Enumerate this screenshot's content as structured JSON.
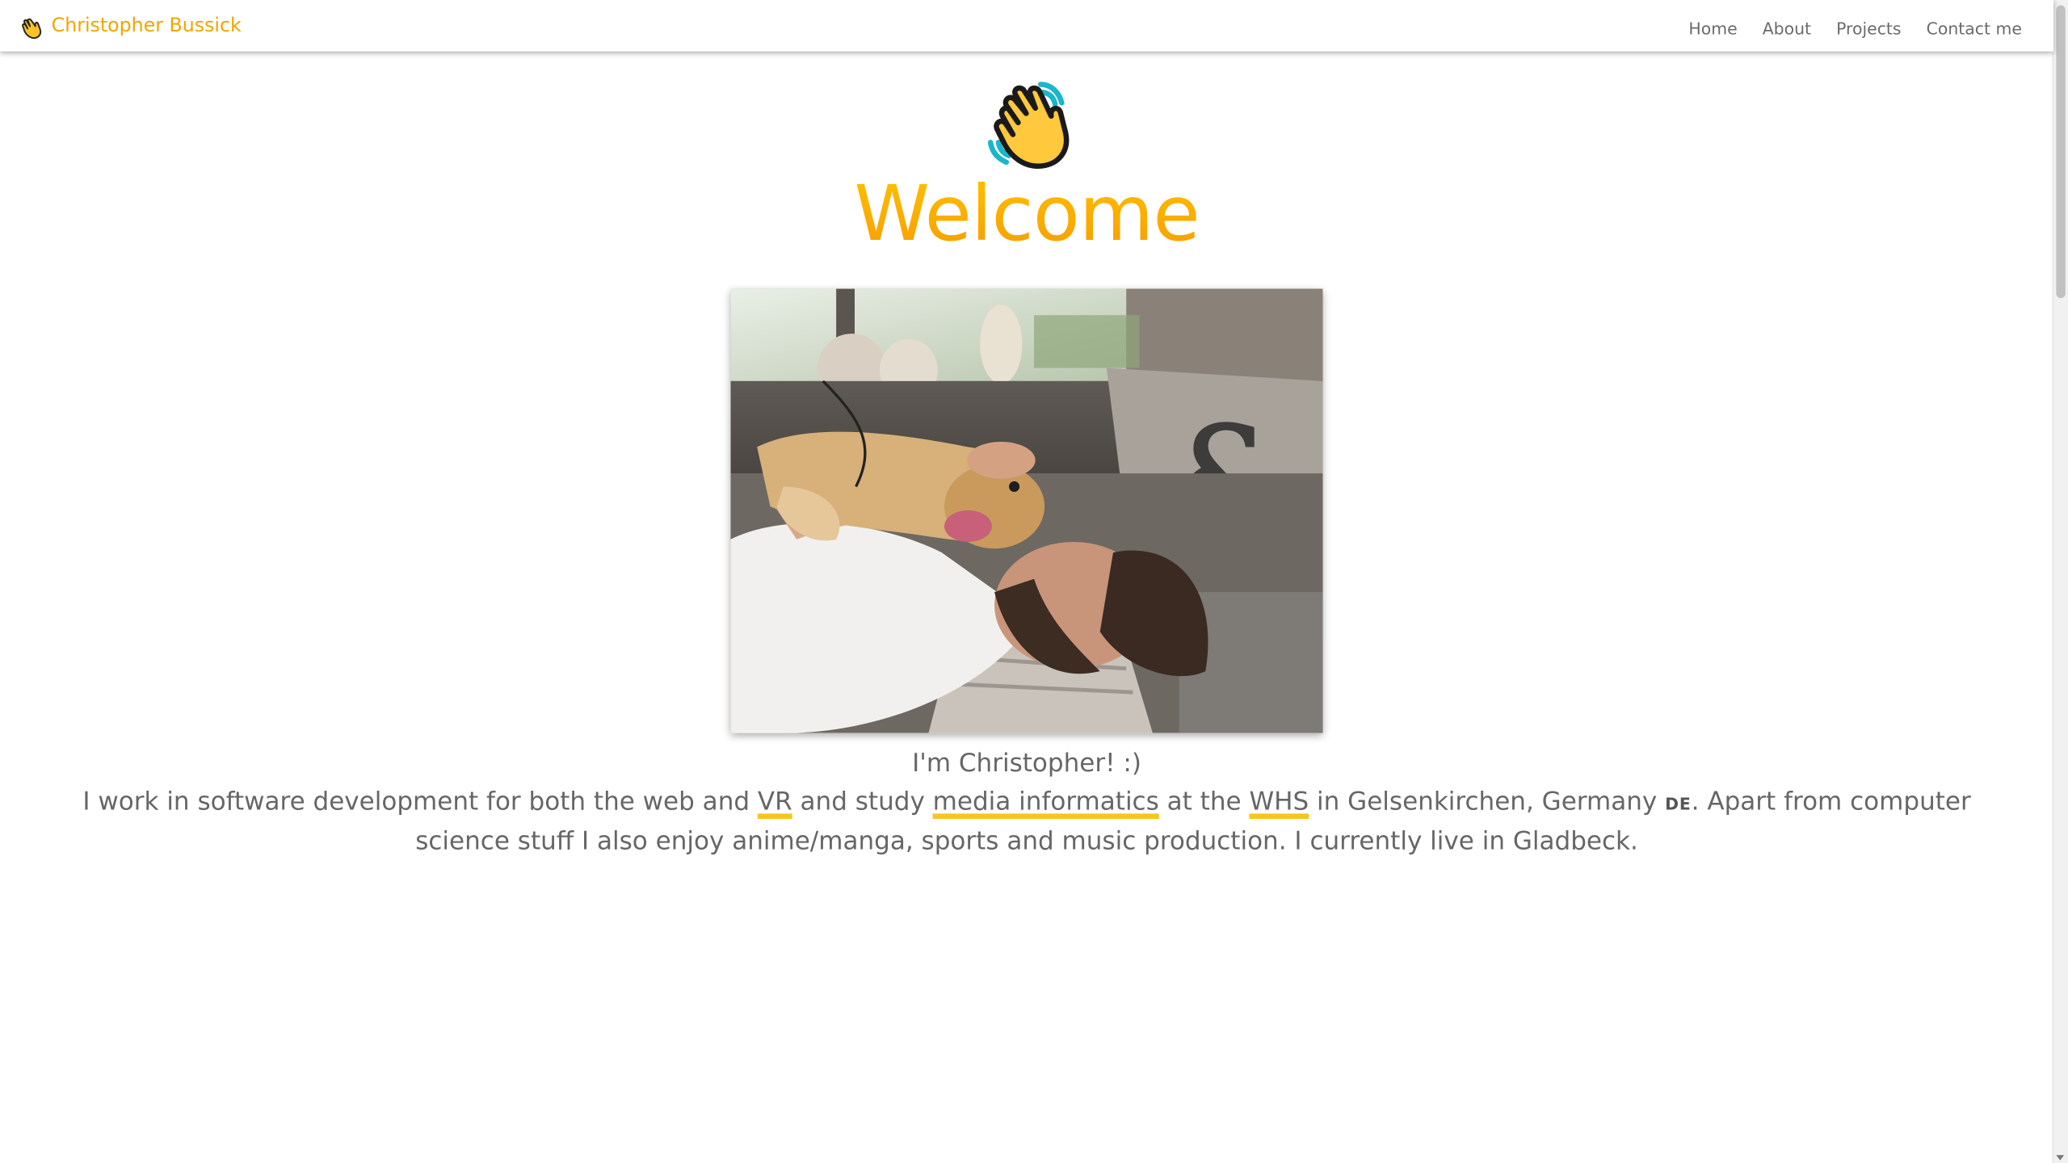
{
  "navbar": {
    "brand_name": "Christopher Bussick",
    "brand_icon": "waving-hand-icon",
    "links": [
      "Home",
      "About",
      "Projects",
      "Contact me"
    ]
  },
  "hero": {
    "icon": "waving-hand-icon",
    "title": "Welcome"
  },
  "photo": {
    "alt": "Christopher lying on a couch with his dog"
  },
  "content": {
    "intro": "I'm Christopher! :)",
    "bio_1": "I work in software development for both the web and ",
    "bio_vr": "VR",
    "bio_2": " and study ",
    "bio_media": "media informatics",
    "bio_3": " at the ",
    "bio_whs": "WHS",
    "bio_4": " in Gelsenkirchen, Germany ",
    "bio_flag": "DE",
    "bio_5": ". Apart from computer science stuff I also enjoy anime/manga, sports and music production. I currently live in Gladbeck."
  },
  "colors": {
    "accent": "#f4a400",
    "highlight": "#f8c51c",
    "text": "#666666"
  }
}
